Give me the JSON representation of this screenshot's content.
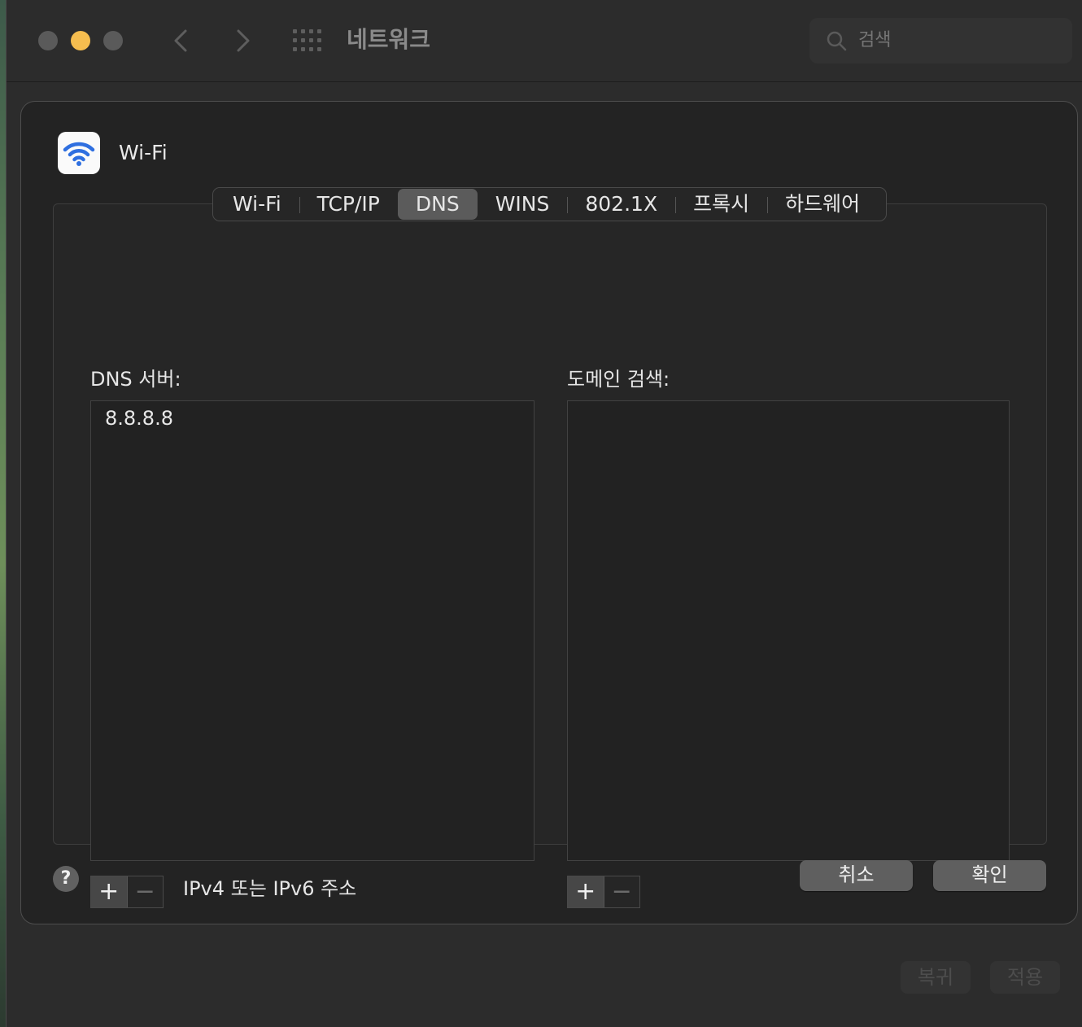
{
  "window": {
    "title": "네트워크",
    "search_placeholder": "검색"
  },
  "sheet": {
    "service_name": "Wi-Fi",
    "tabs": [
      {
        "label": "Wi-Fi",
        "active": false
      },
      {
        "label": "TCP/IP",
        "active": false
      },
      {
        "label": "DNS",
        "active": true
      },
      {
        "label": "WINS",
        "active": false
      },
      {
        "label": "802.1X",
        "active": false
      },
      {
        "label": "프록시",
        "active": false
      },
      {
        "label": "하드웨어",
        "active": false
      }
    ],
    "dns": {
      "label": "DNS 서버:",
      "servers": [
        "8.8.8.8"
      ],
      "add_symbol": "+",
      "remove_symbol": "−",
      "hint": "IPv4 또는 IPv6 주소"
    },
    "domains": {
      "label": "도메인 검색:",
      "entries": [],
      "add_symbol": "+",
      "remove_symbol": "−"
    },
    "help_label": "?",
    "cancel_label": "취소",
    "ok_label": "확인"
  },
  "footer": {
    "revert_label": "복귀",
    "apply_label": "적용"
  },
  "colors": {
    "minimize": "#f5bd4f",
    "wifi_blue": "#2f6fe0",
    "active_tab": "#5b5b5b"
  }
}
